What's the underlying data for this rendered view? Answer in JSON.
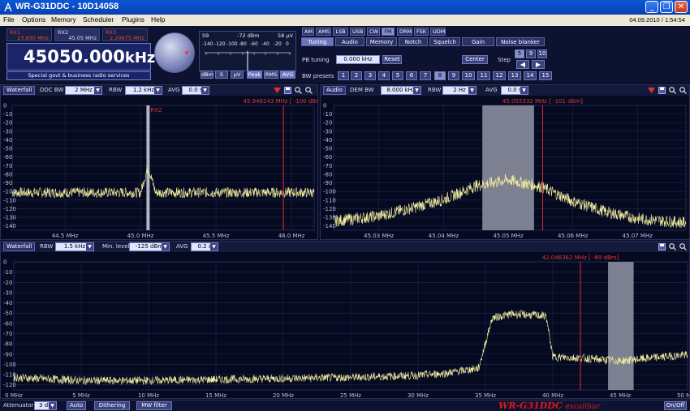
{
  "window": {
    "title": "WR-G31DDC - 10D14058",
    "icon": "antenna-icon"
  },
  "menu": {
    "items": [
      "File",
      "Options",
      "Memory",
      "Scheduler",
      "Plugins",
      "Help"
    ],
    "datetime": "04.09.2010 / 1:54:54"
  },
  "receivers": [
    {
      "name": "RX1",
      "freq": "23.830 MHz"
    },
    {
      "name": "RX2",
      "freq": "45.05 MHz"
    },
    {
      "name": "RX3",
      "freq": "2.20675 MHz"
    }
  ],
  "frequency": {
    "value": "45050.000",
    "unit": "kHz",
    "description": "Special govt & business radio services"
  },
  "smeter": {
    "label": "S9",
    "dbm": "-72 dBm",
    "uv": "58 µV",
    "scale": [
      "-140",
      "-120",
      "-100",
      "-80",
      "-60",
      "-40",
      "-20",
      "0"
    ],
    "buttons": [
      "dBm",
      "S",
      "µV",
      "Peak",
      "RMS",
      "AVG"
    ],
    "selected": [
      "Peak",
      "AVG"
    ]
  },
  "modes": {
    "items": [
      "AM",
      "AMS",
      "LSB",
      "USB",
      "CW",
      "FM",
      "DRM",
      "FSK",
      "UDM"
    ],
    "selected": "FM"
  },
  "tabs": {
    "items": [
      "Tuning",
      "Audio",
      "Memory",
      "Notch",
      "Squelch",
      "Gain",
      "Noise blanker"
    ],
    "selected": "Tuning"
  },
  "tuning": {
    "pb_tuning_label": "PB tuning",
    "pb_value": "0.000 kHz",
    "reset": "Reset",
    "center": "Center",
    "step_label": "Step",
    "step_options": [
      "5",
      "9",
      "10"
    ],
    "step_selected": "5",
    "bw_presets_label": "BW presets",
    "bw_presets": [
      "1",
      "2",
      "3",
      "4",
      "5",
      "6",
      "7",
      "8",
      "9",
      "10",
      "11",
      "12",
      "13",
      "14",
      "15"
    ],
    "bw_selected": "8"
  },
  "panel1": {
    "mode": "Waterfall",
    "ddc_bw_label": "DDC BW",
    "ddc_bw": "2 MHz",
    "rbw_label": "RBW",
    "rbw": "1.2 kHz",
    "avg_label": "AVG",
    "avg": "0.0 s",
    "readout": "45.946243 MHz [ -100 dBm]",
    "marker_label": "RX2",
    "yticks": [
      "0",
      "-10",
      "-20",
      "-30",
      "-40",
      "-50",
      "-60",
      "-70",
      "-80",
      "-90",
      "-100",
      "-110",
      "-120",
      "-130",
      "-140"
    ],
    "xticks": [
      "44.5 MHz",
      "45.0 MHz",
      "45.5 MHz",
      "46.0 MHz"
    ]
  },
  "panel2": {
    "mode": "Audio",
    "dem_bw_label": "DEM BW",
    "dem_bw": "8.000 kHz",
    "rbw_label": "RBW",
    "rbw": "2 Hz",
    "avg_label": "AVG",
    "avg": "0.0 s",
    "readout": "45.055332 MHz [ -101 dBm]",
    "yticks": [
      "0",
      "-10",
      "-20",
      "-30",
      "-40",
      "-50",
      "-60",
      "-70",
      "-80",
      "-90",
      "-100",
      "-110",
      "-120",
      "-130",
      "-140"
    ],
    "xticks": [
      "45.03 MHz",
      "45.04 MHz",
      "45.05 MHz",
      "45.06 MHz",
      "45.07 MHz"
    ]
  },
  "panel3": {
    "mode": "Waterfall",
    "rbw_label": "RBW",
    "rbw": "1.5 kHz",
    "min_level_label": "Min. level",
    "min_level": "-125 dBm",
    "avg_label": "AVG",
    "avg": "0.2 s",
    "readout": "42.046362 MHz [ -89 dBm]",
    "yticks": [
      "0",
      "-10",
      "-20",
      "-30",
      "-40",
      "-50",
      "-60",
      "-70",
      "-80",
      "-90",
      "-100",
      "-110",
      "-120"
    ],
    "xticks": [
      "0 MHz",
      "5 MHz",
      "10 MHz",
      "15 MHz",
      "20 MHz",
      "25 MHz",
      "30 MHz",
      "35 MHz",
      "40 MHz",
      "45 MHz",
      "50 MHz"
    ]
  },
  "statusbar": {
    "attenuator_label": "Attenuator",
    "attenuator": "3 dB",
    "auto": "Auto",
    "dithering": "Dithering",
    "mw_filter": "MW filter",
    "brand": "WR-G31DDC",
    "brand_sub": "excalibur",
    "onoff": "On/Off"
  },
  "colors": {
    "trace": "#f5f0a0",
    "marker": "#e03030",
    "filter": "#8a8d9c",
    "background": "#050a20"
  },
  "chart_data": [
    {
      "type": "line",
      "title": "",
      "xlabel": "",
      "ylabel": "",
      "xlim": [
        44.15,
        46.15
      ],
      "ylim": [
        -145,
        0
      ],
      "series": [
        {
          "x": [
            44.15,
            44.5,
            44.8,
            45.0,
            45.05,
            45.1,
            45.5,
            45.9,
            46.15
          ],
          "y": [
            -100,
            -100,
            -100,
            -100,
            -70,
            -100,
            -100,
            -100,
            -100
          ]
        }
      ],
      "annotations": [
        {
          "x": 45.05,
          "text": "RX2"
        },
        {
          "x": 45.946243,
          "text": "45.946243 MHz [ -100 dBm]"
        }
      ]
    },
    {
      "type": "line",
      "title": "",
      "xlabel": "",
      "ylabel": "",
      "xlim": [
        45.023,
        45.0775
      ],
      "ylim": [
        -145,
        0
      ],
      "series": [
        {
          "x": [
            45.023,
            45.03,
            45.035,
            45.04,
            45.045,
            45.05,
            45.055,
            45.06,
            45.065,
            45.07,
            45.0775
          ],
          "y": [
            -133,
            -127,
            -118,
            -108,
            -92,
            -85,
            -93,
            -110,
            -122,
            -130,
            -135
          ]
        }
      ],
      "filter_band": [
        45.046,
        45.054
      ],
      "annotations": [
        {
          "x": 45.055332,
          "text": "45.055332 MHz [ -101 dBm]"
        }
      ]
    },
    {
      "type": "line",
      "title": "",
      "xlabel": "",
      "ylabel": "",
      "xlim": [
        0,
        50
      ],
      "ylim": [
        -125,
        0
      ],
      "series": [
        {
          "x": [
            0,
            5,
            10,
            15,
            20,
            25,
            30,
            32,
            34.5,
            35.5,
            37,
            39.5,
            40,
            42,
            45,
            48,
            50
          ],
          "y": [
            -112,
            -115,
            -115,
            -114,
            -113,
            -112,
            -110,
            -108,
            -103,
            -54,
            -50,
            -52,
            -92,
            -93,
            -96,
            -92,
            -90
          ]
        }
      ],
      "filter_band": [
        44.1,
        46.0
      ],
      "annotations": [
        {
          "x": 42.046362,
          "text": "42.046362 MHz [ -89 dBm]"
        }
      ]
    }
  ]
}
